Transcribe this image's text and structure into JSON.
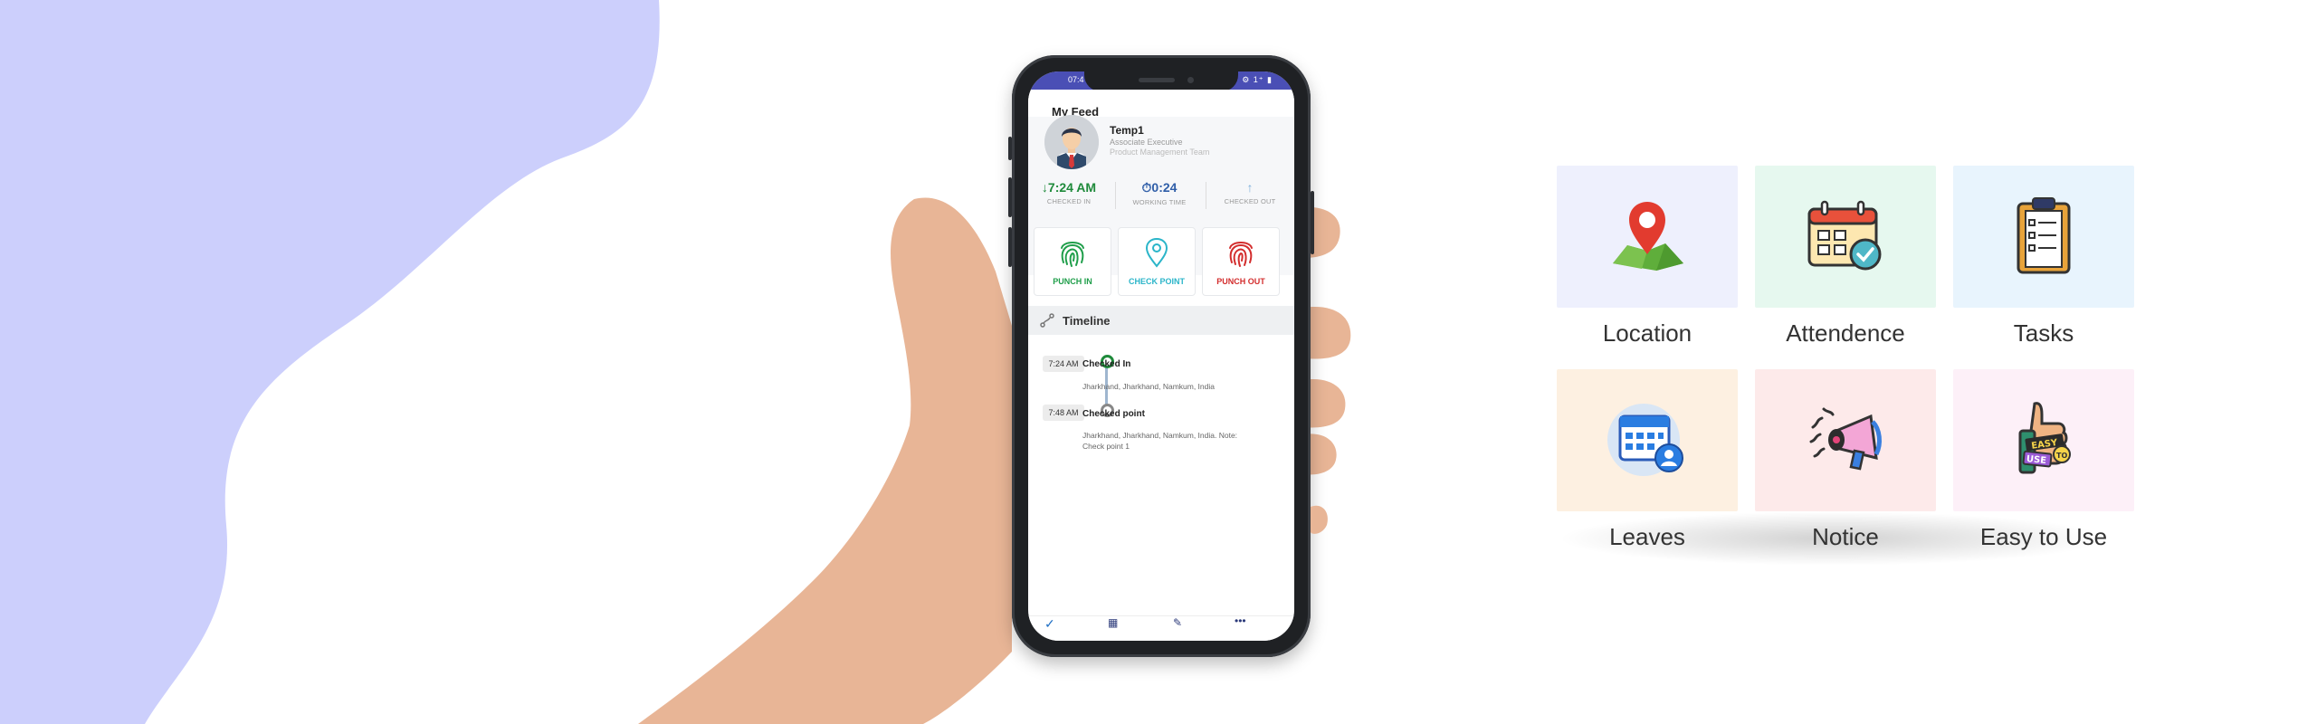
{
  "phone": {
    "status_time": "07:4",
    "status_icons": "⚙ 1⁺ ▮",
    "feed_title": "My Feed",
    "profile": {
      "name": "Temp1",
      "role": "Associate Executive",
      "team": "Product Management Team"
    },
    "stats": [
      {
        "value": "↓7:24 AM",
        "label": "CHECKED IN",
        "color": "#1f8a3b"
      },
      {
        "value": "⏱0:24",
        "label": "WORKING TIME",
        "color": "#2f5ea8"
      },
      {
        "value": "↑",
        "label": "CHECKED OUT",
        "color": "#7fb0dd"
      }
    ],
    "actions": [
      {
        "label": "PUNCH IN",
        "color": "#1f9e4a"
      },
      {
        "label": "CHECK POINT",
        "color": "#2bb5c9"
      },
      {
        "label": "PUNCH OUT",
        "color": "#d32d2d"
      }
    ],
    "timeline_title": "Timeline",
    "timeline": [
      {
        "time": "7:24 AM",
        "title": "Checked In",
        "address": "Jharkhand, Jharkhand, Namkum, India"
      },
      {
        "time": "7:48 AM",
        "title": "Checked point",
        "address": "Jharkhand, Jharkhand, Namkum, India. Note: Check point 1"
      }
    ],
    "nav": [
      "✓",
      "▦",
      "✎",
      "•••"
    ]
  },
  "features": [
    {
      "label": "Location",
      "bg": "#eef0fd",
      "icon": "map-pin-icon"
    },
    {
      "label": "Attendence",
      "bg": "#e6f8ef",
      "icon": "calendar-check-icon"
    },
    {
      "label": "Tasks",
      "bg": "#e8f4fd",
      "icon": "clipboard-checklist-icon"
    },
    {
      "label": "Leaves",
      "bg": "#fdf0e1",
      "icon": "calendar-user-icon"
    },
    {
      "label": "Notice",
      "bg": "#fdeaea",
      "icon": "megaphone-icon"
    },
    {
      "label": "Easy to Use",
      "bg": "#fdf0f8",
      "icon": "thumbs-up-easy-icon"
    }
  ],
  "colors": {
    "blob": "#cccffc",
    "status_bar": "#4a4fb5"
  }
}
